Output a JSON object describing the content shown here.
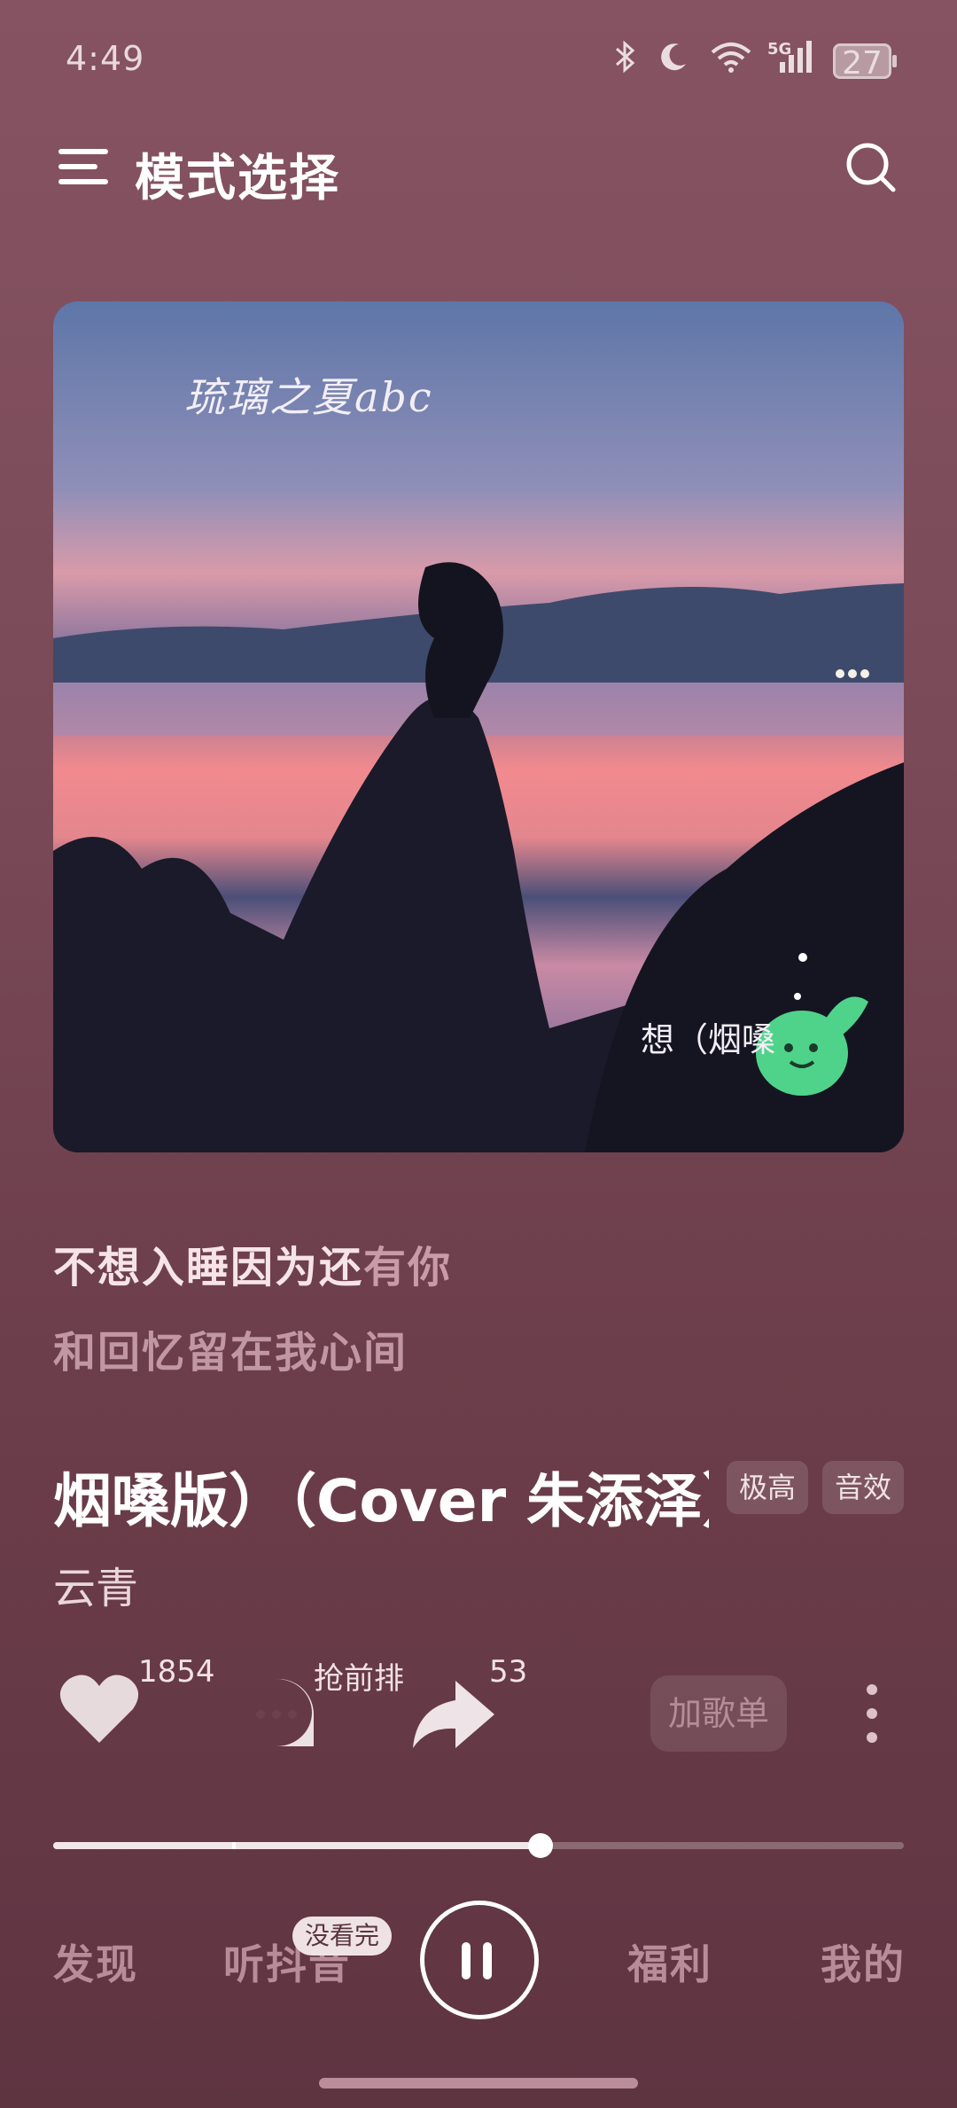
{
  "status_bar": {
    "time": "4:49",
    "network": "5G",
    "battery": "27"
  },
  "header": {
    "title": "模式选择"
  },
  "cover": {
    "caption_top": "琉璃之夏abc",
    "caption_bottom": "想（烟嗓"
  },
  "lyrics": {
    "line1_sung": "不想入睡因为还",
    "line1_rest": "有你",
    "line2": "和回忆留在我心间"
  },
  "song": {
    "title": "烟嗓版）（Cover 朱添泽）",
    "badges": [
      "极高",
      "音效"
    ],
    "artist": "云青"
  },
  "actions": {
    "like_count": "1854",
    "comment_label": "抢前排",
    "share_count": "53",
    "add_playlist": "加歌单"
  },
  "progress": {
    "played_fraction": 0.573,
    "buffered_marker_fraction": 0.21
  },
  "nav": {
    "items": [
      "发现",
      "听抖音",
      "福利",
      "我的"
    ],
    "badge": "没看完"
  },
  "icons": [
    "menu-icon",
    "search-icon",
    "heart-icon",
    "comment-icon",
    "share-icon",
    "more-icon",
    "pause-icon"
  ]
}
